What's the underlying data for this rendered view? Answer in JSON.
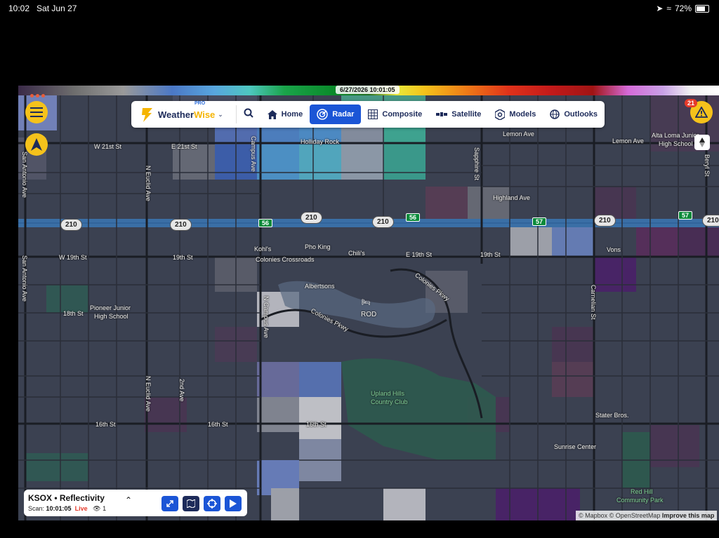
{
  "status_bar": {
    "time": "10:02",
    "date": "Sat Jun 27",
    "battery": "72%",
    "battery_level": 0.72
  },
  "colorbar": {
    "timestamp": "6/27/2026 10:01:05"
  },
  "nav": {
    "brand": "Weather",
    "brand_accent": "Wise",
    "brand_pro": "PRO",
    "items": [
      {
        "label": "Home",
        "icon": "home-icon"
      },
      {
        "label": "Radar",
        "icon": "radar-icon",
        "active": true
      },
      {
        "label": "Composite",
        "icon": "grid-icon"
      },
      {
        "label": "Satellite",
        "icon": "satellite-icon"
      },
      {
        "label": "Models",
        "icon": "hexagon-icon"
      },
      {
        "label": "Outlooks",
        "icon": "globe-icon"
      }
    ]
  },
  "alerts": {
    "count": "21"
  },
  "map_labels": {
    "streets": {
      "w21": "W 21st St",
      "e21": "E 21st St",
      "w19": "W 19th St",
      "st19": "19th St",
      "e19": "E 19th St",
      "st19b": "19th St",
      "st18": "18th St",
      "st16a": "16th St",
      "st16b": "16th St",
      "st16c": "16th St",
      "lemon1": "Lemon Ave",
      "lemon2": "Lemon Ave",
      "highland": "Highland Ave",
      "san_antonio1": "San Antonio Ave",
      "san_antonio2": "San Antonio Ave",
      "euclid1": "N Euclid Ave",
      "euclid2": "N Euclid Ave",
      "campus1": "Campus Ave",
      "campus2": "N Campus Ave",
      "second": "2nd Ave",
      "sapphire": "Sapphire St",
      "carnelian": "Carnelian St",
      "beryl": "Beryl St",
      "colonies1": "Colonies Pkwy",
      "colonies2": "Colonies Pkwy"
    },
    "places": {
      "holliday": "Holliday Rock",
      "kohls": "Kohl's",
      "pho": "Pho King",
      "chilis": "Chili's",
      "colonies": "Colonies Crossroads",
      "albertsons": "Albertsons",
      "rod": "ROD",
      "pioneer1": "Pioneer Junior",
      "pioneer2": "High School",
      "alta1": "Alta Loma Junior",
      "alta2": "High School",
      "vons": "Vons",
      "upland1": "Upland Hills",
      "upland2": "Country Club",
      "stater": "Stater Bros.",
      "sunrise": "Sunrise Center",
      "redhill1": "Red Hill",
      "redhill2": "Community Park"
    },
    "shields": {
      "h210a": "210",
      "h210b": "210",
      "h210c": "210",
      "h210d": "210",
      "h210e": "210",
      "h210f": "210",
      "s56a": "56",
      "s56b": "56",
      "s57a": "57",
      "s57b": "57"
    }
  },
  "scan_panel": {
    "title": "KSOX • Reflectivity",
    "scan_label": "Scan:",
    "scan_time": "10:01:05",
    "live": "Live",
    "viewers": "1"
  },
  "attribution": {
    "mapbox": "© Mapbox",
    "osm": "© OpenStreetMap",
    "improve": "Improve this map"
  },
  "colors": {
    "accent_yellow": "#f5c21b",
    "primary_blue": "#1b55d6",
    "navy": "#1d2b5a",
    "map_bg": "#3b4151",
    "live_red": "#e53a2a"
  }
}
